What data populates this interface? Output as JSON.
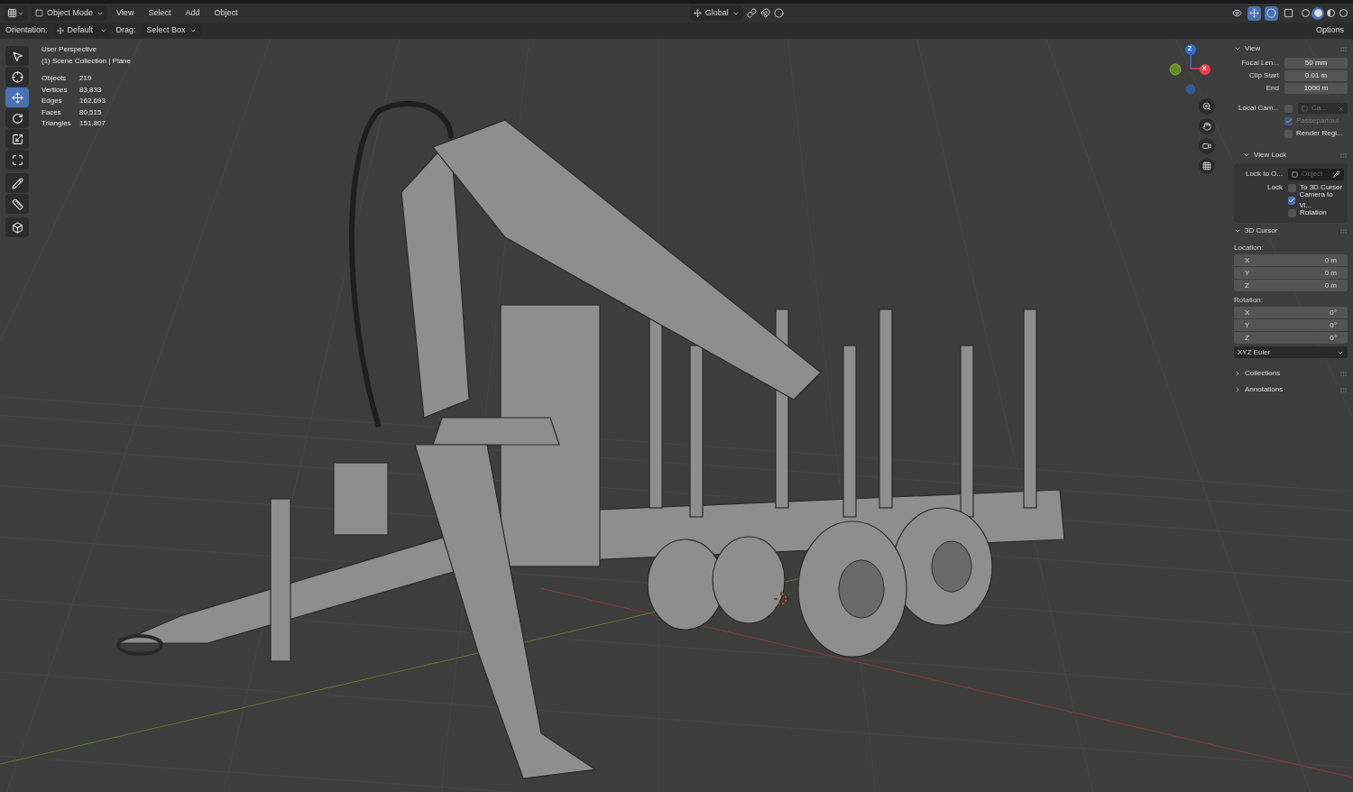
{
  "header": {
    "mode": "Object Mode",
    "menus": [
      "View",
      "Select",
      "Add",
      "Object"
    ],
    "transform_orientation": "Global",
    "viewport_toggles": [
      {
        "kind": "visibility",
        "on": false
      },
      {
        "kind": "gizmo",
        "on": true
      },
      {
        "kind": "overlay",
        "on": true
      },
      {
        "kind": "xray",
        "on": false
      }
    ],
    "shading_modes": [
      {
        "kind": "wireframe",
        "selected": false
      },
      {
        "kind": "solid",
        "selected": true
      },
      {
        "kind": "material",
        "selected": false
      },
      {
        "kind": "rendered",
        "selected": false
      }
    ]
  },
  "tool_settings": {
    "orientation_label": "Orientation:",
    "orientation": "Default",
    "drag_label": "Drag:",
    "drag": "Select Box",
    "options": "Options"
  },
  "toolbar": [
    {
      "kind": "select",
      "selected": false
    },
    {
      "kind": "cursor",
      "selected": false
    },
    {
      "kind": "move",
      "selected": true
    },
    {
      "kind": "rotate",
      "selected": false
    },
    {
      "kind": "scale",
      "selected": false
    },
    {
      "kind": "transform",
      "selected": false
    },
    {
      "kind": "annotate",
      "selected": false
    },
    {
      "kind": "measure",
      "selected": false
    },
    {
      "kind": "add-cube",
      "selected": false
    }
  ],
  "overlay": {
    "view_name": "User Perspective",
    "collection": "(1) Scene Collection | Plane",
    "stats": [
      {
        "label": "Objects",
        "value": "219"
      },
      {
        "label": "Vertices",
        "value": "83,833"
      },
      {
        "label": "Edges",
        "value": "162,693"
      },
      {
        "label": "Faces",
        "value": "80,515"
      },
      {
        "label": "Triangles",
        "value": "151,807"
      }
    ]
  },
  "gizmo": {
    "z_label": "Z",
    "x_label": "X"
  },
  "sidebar": {
    "sections": [
      {
        "title": "View",
        "expanded": true,
        "rows": [
          {
            "kind": "field",
            "label": "Focal Len...",
            "value": "50 mm"
          },
          {
            "kind": "field",
            "label": "Clip Start",
            "value": "0.01 m"
          },
          {
            "kind": "field",
            "label": "End",
            "value": "1000 m"
          },
          {
            "kind": "camera",
            "label": "Local Cam...",
            "checked": false,
            "placeholder": "Ca..."
          },
          {
            "kind": "check",
            "label": "Passepartout",
            "checked": true,
            "disabled": true
          },
          {
            "kind": "check",
            "label": "Render Regi...",
            "checked": false,
            "disabled": false
          }
        ]
      },
      {
        "title": "View Lock",
        "expanded": true,
        "rows": [
          {
            "kind": "object",
            "label": "Lock to O...",
            "placeholder": "Object"
          },
          {
            "kind": "check",
            "label": "To 3D Cursor",
            "side_label": "Lock",
            "checked": false,
            "disabled": false
          },
          {
            "kind": "check",
            "label": "Camera to Vi...",
            "checked": true,
            "disabled": false
          },
          {
            "kind": "check",
            "label": "Rotation",
            "checked": false,
            "disabled": false
          }
        ]
      },
      {
        "title": "3D Cursor",
        "expanded": true,
        "rows": [
          {
            "kind": "heading",
            "label": "Location:"
          },
          {
            "kind": "vector",
            "items": [
              {
                "axis": "X",
                "value": "0 m"
              },
              {
                "axis": "Y",
                "value": "0 m"
              },
              {
                "axis": "Z",
                "value": "0 m"
              }
            ]
          },
          {
            "kind": "heading",
            "label": "Rotation:"
          },
          {
            "kind": "vector",
            "items": [
              {
                "axis": "X",
                "value": "0°"
              },
              {
                "axis": "Y",
                "value": "0°"
              },
              {
                "axis": "Z",
                "value": "0°"
              }
            ]
          },
          {
            "kind": "dropdown",
            "value": "XYZ Euler"
          }
        ]
      },
      {
        "title": "Collections",
        "expanded": false
      },
      {
        "title": "Annotations",
        "expanded": false
      }
    ]
  }
}
